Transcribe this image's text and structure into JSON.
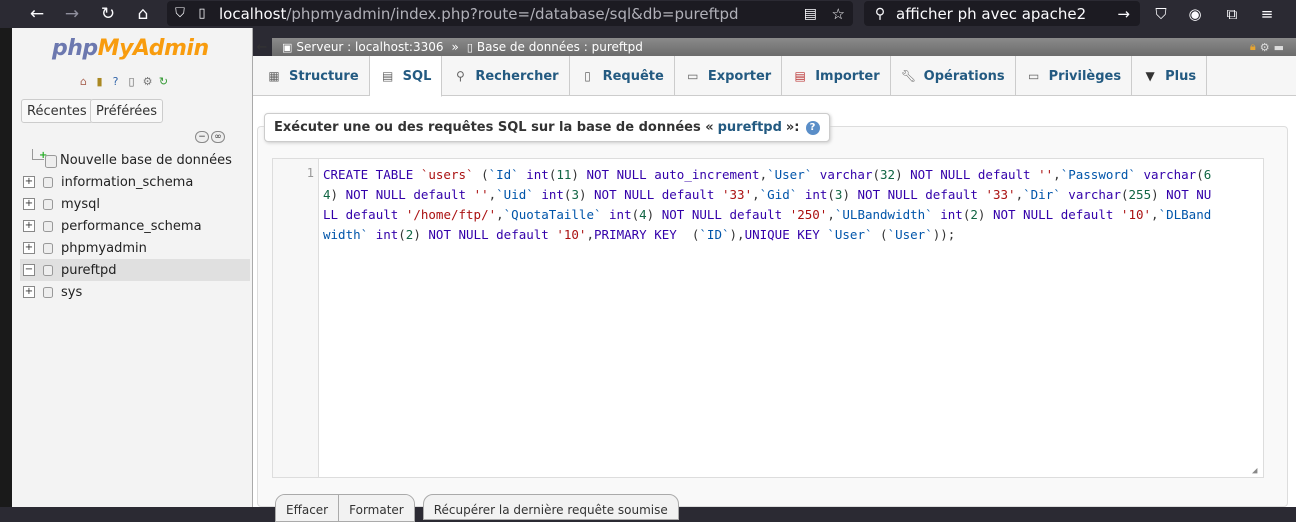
{
  "browser": {
    "url_host": "localhost",
    "url_path": "/phpmyadmin/index.php?route=/database/sql&db=pureftpd",
    "search_text": "afficher ph avec apache2"
  },
  "nav": {
    "logo_part1": "php",
    "logo_part2": "MyAdmin",
    "tab_recent": "Récentes",
    "tab_favorites": "Préférées",
    "new_db": "Nouvelle base de données",
    "databases": [
      {
        "name": "information_schema",
        "expander": "+"
      },
      {
        "name": "mysql",
        "expander": "+"
      },
      {
        "name": "performance_schema",
        "expander": "+"
      },
      {
        "name": "phpmyadmin",
        "expander": "+"
      },
      {
        "name": "pureftpd",
        "expander": "−"
      },
      {
        "name": "sys",
        "expander": "+"
      }
    ]
  },
  "breadcrumb": {
    "server": "Serveur : localhost:3306",
    "separator": "»",
    "database": "Base de données : pureftpd"
  },
  "tabs": [
    {
      "label": "Structure",
      "icon": "structure-icon"
    },
    {
      "label": "SQL",
      "icon": "sql-icon"
    },
    {
      "label": "Rechercher",
      "icon": "search-icon"
    },
    {
      "label": "Requête",
      "icon": "query-icon"
    },
    {
      "label": "Exporter",
      "icon": "export-icon"
    },
    {
      "label": "Importer",
      "icon": "import-icon"
    },
    {
      "label": "Opérations",
      "icon": "wrench-icon"
    },
    {
      "label": "Privilèges",
      "icon": "privileges-icon"
    },
    {
      "label": "Plus",
      "icon": "chevron-down-icon"
    }
  ],
  "sql_panel": {
    "title": "Exécuter une ou des requêtes SQL sur la base de données «",
    "db_name": "pureftpd",
    "title_end": "»:",
    "line_number": "1"
  },
  "buttons": {
    "clear": "Effacer",
    "format": "Formater",
    "last_query": "Récupérer la dernière requête soumise"
  }
}
